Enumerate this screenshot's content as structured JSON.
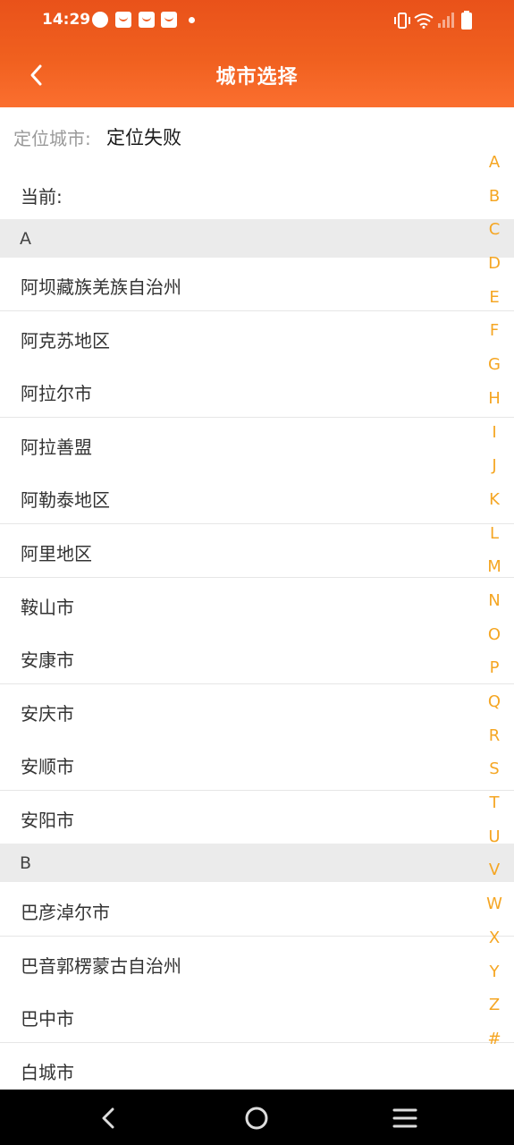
{
  "status_bar": {
    "time": "14:29",
    "left_icons": [
      "speedometer-icon",
      "shopping-bag-icon",
      "shopping-bag-icon",
      "shopping-bag-icon",
      "dot-icon"
    ],
    "right_icons": [
      "vibrate-icon",
      "wifi-icon",
      "signal-icon",
      "battery-icon"
    ]
  },
  "header": {
    "title": "城市选择",
    "back_icon": "chevron-left-icon",
    "bg_color": "#ee591e"
  },
  "location": {
    "label": "定位城市:",
    "value": "定位失败"
  },
  "current": {
    "label": "当前:"
  },
  "sections": [
    {
      "letter": "A",
      "cities": [
        "阿坝藏族羌族自治州",
        "阿克苏地区",
        "阿拉尔市",
        "阿拉善盟",
        "阿勒泰地区",
        "阿里地区",
        "鞍山市",
        "安康市",
        "安庆市",
        "安顺市",
        "安阳市"
      ]
    },
    {
      "letter": "B",
      "cities": [
        "巴彦淖尔市",
        "巴音郭楞蒙古自治州",
        "巴中市",
        "白城市"
      ]
    }
  ],
  "index_letters": [
    "A",
    "B",
    "C",
    "D",
    "E",
    "F",
    "G",
    "H",
    "I",
    "J",
    "K",
    "L",
    "M",
    "N",
    "O",
    "P",
    "Q",
    "R",
    "S",
    "T",
    "U",
    "V",
    "W",
    "X",
    "Y",
    "Z",
    "#"
  ],
  "accent_color": "#f5a623",
  "nav_bar": [
    "back-icon",
    "home-icon",
    "menu-icon"
  ]
}
